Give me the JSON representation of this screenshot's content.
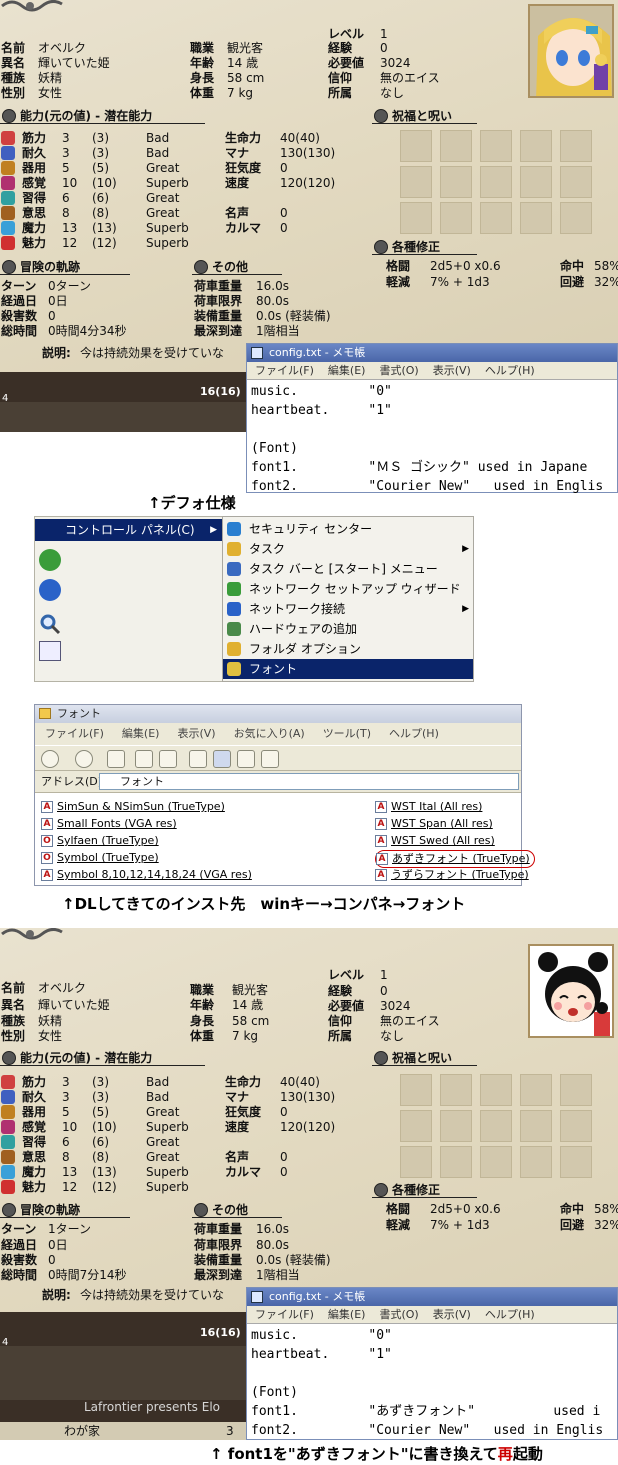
{
  "screen1": {
    "char": {
      "name_label": "名前",
      "name": "オベルク",
      "alias_label": "異名",
      "alias": "輝いていた姫",
      "race_label": "種族",
      "race": "妖精",
      "sex_label": "性別",
      "sex": "女性",
      "class_label": "職業",
      "class": "観光客",
      "age_label": "年齢",
      "age": "14 歳",
      "height_label": "身長",
      "height": "58 cm",
      "weight_label": "体重",
      "weight": "7 kg",
      "level_label": "レベル",
      "level": "1",
      "exp_label": "経験",
      "exp": "0",
      "req_label": "必要値",
      "req": "3024",
      "faith_label": "信仰",
      "faith": "無のエイス",
      "guild_label": "所属",
      "guild": "なし"
    },
    "abilities_title": "能力(元の値) - 潜在能力",
    "abilities": [
      {
        "name": "筋力",
        "val": "3",
        "orig": "(3)",
        "pot": "Bad"
      },
      {
        "name": "耐久",
        "val": "3",
        "orig": "(3)",
        "pot": "Bad"
      },
      {
        "name": "器用",
        "val": "5",
        "orig": "(5)",
        "pot": "Great"
      },
      {
        "name": "感覚",
        "val": "10",
        "orig": "(10)",
        "pot": "Superb"
      },
      {
        "name": "習得",
        "val": "6",
        "orig": "(6)",
        "pot": "Great"
      },
      {
        "name": "意思",
        "val": "8",
        "orig": "(8)",
        "pot": "Great"
      },
      {
        "name": "魔力",
        "val": "13",
        "orig": "(13)",
        "pot": "Superb"
      },
      {
        "name": "魅力",
        "val": "12",
        "orig": "(12)",
        "pot": "Superb"
      }
    ],
    "vitals": {
      "life_label": "生命力",
      "life": "40(40)",
      "mana_label": "マナ",
      "mana": "130(130)",
      "insanity_label": "狂気度",
      "insanity": "0",
      "speed_label": "速度",
      "speed": "120(120)",
      "fame_label": "名声",
      "fame": "0",
      "karma_label": "カルマ",
      "karma": "0"
    },
    "blessing_title": "祝福と呪い",
    "mods_title": "各種修正",
    "mods": {
      "melee_label": "格闘",
      "melee": "2d5+0 x0.6",
      "reduce_label": "軽減",
      "reduce": "7% + 1d3",
      "hit_label": "命中",
      "hit": "58%",
      "evade_label": "回避",
      "evade": "32%"
    },
    "adv_title": "冒険の軌跡",
    "adv": {
      "turn_label": "ターン",
      "turn": "0ターン",
      "days_label": "経過日",
      "days": "0日",
      "kills_label": "殺害数",
      "kills": "0",
      "time_label": "総時間",
      "time": "0時間4分34秒"
    },
    "other_title": "その他",
    "other": {
      "cargo_label": "荷車重量",
      "cargo": "16.0s",
      "limit_label": "荷車限界",
      "limit": "80.0s",
      "equip_label": "装備重量",
      "equip": "0.0s (軽装備)",
      "deep_label": "最深到達",
      "deep": "1階相当"
    },
    "desc_label": "説明:",
    "desc": "今は持続効果を受けていな",
    "hp_readout": "16(16)",
    "game_left_num": "4",
    "presents": "Lafrontier presents Elo",
    "home_label": "わが家",
    "notepad": {
      "title": "config.txt - メモ帳",
      "menus": [
        "ファイル(F)",
        "編集(E)",
        "書式(O)",
        "表示(V)",
        "ヘルプ(H)"
      ],
      "lines": [
        "music.         \"0\"",
        "heartbeat.     \"1\"",
        "",
        "(Font)",
        "font1.         \"ＭＳ ゴシック\" used in Japane",
        "font2.         \"Courier New\"   used in Englis"
      ]
    }
  },
  "caption1": "↑デフォ仕様",
  "control_panel": {
    "selected": "コントロール パネル(C)",
    "items": [
      "セキュリティ センター",
      "タスク",
      "タスク バーと [スタート] メニュー",
      "ネットワーク セットアップ ウィザード",
      "ネットワーク接続",
      "ハードウェアの追加",
      "フォルダ オプション",
      "フォント"
    ]
  },
  "fonts_window": {
    "title": "フォント",
    "menus": [
      "ファイル(F)",
      "編集(E)",
      "表示(V)",
      "お気に入り(A)",
      "ツール(T)",
      "ヘルプ(H)"
    ],
    "address_label": "アドレス(D)",
    "address": "フォント",
    "left_items": [
      "SimSun & NSimSun (TrueType)",
      "Small Fonts (VGA res)",
      "Sylfaen (TrueType)",
      "Symbol (TrueType)",
      "Symbol 8,10,12,14,18,24 (VGA res)"
    ],
    "right_items": [
      "WST Ital (All res)",
      "WST Span (All res)",
      "WST Swed (All res)",
      "あずきフォント (TrueType)",
      "うずらフォント (TrueType)"
    ]
  },
  "caption2": "↑DLしてきてのインスト先　winキー→コンパネ→フォント",
  "screen2": {
    "adv_turn": "1ターン",
    "adv_time": "0時間7分14秒",
    "home_count": "3",
    "notepad_lines": [
      "music.         \"0\"",
      "heartbeat.     \"1\"",
      "",
      "(Font)",
      "font1.         \"あずきフォント\"          used i",
      "font2.         \"Courier New\"   used in Englis"
    ]
  },
  "caption3_a": "↑ font1を\"あずきフォント\"に書き換えて",
  "caption3_b": "再",
  "caption3_c": "起動",
  "colors": {
    "accent_red": "#cc0000",
    "selection": "#0a246a",
    "titlebar": "#4a66a8"
  }
}
